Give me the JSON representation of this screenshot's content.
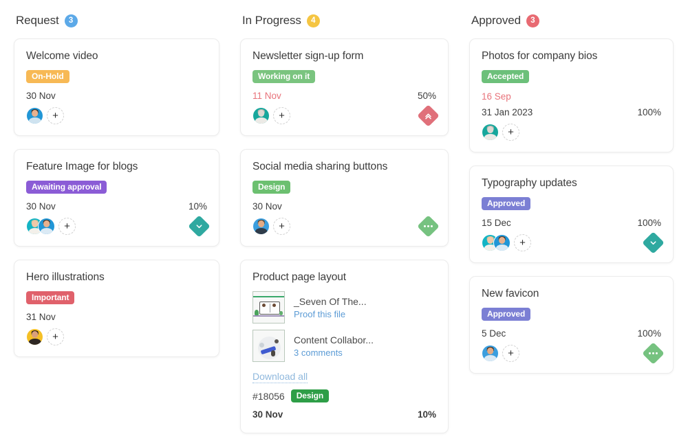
{
  "board": {
    "columns": [
      {
        "title": "Request",
        "count": "3",
        "count_color": "#5ca9e8",
        "cards": [
          {
            "title": "Welcome video",
            "tag": {
              "label": "On-Hold",
              "color": "#f7b955"
            },
            "date": "30 Nov",
            "date_alert": false,
            "percent": "",
            "avatars": [
              {
                "bg": "#2196d6",
                "skin": "#e8b18e",
                "hair": "#3b2a20",
                "body": "#cfe3f0"
              }
            ],
            "add_label": "+",
            "priority": null
          },
          {
            "title": "Feature Image for blogs",
            "tag": {
              "label": "Awaiting approval",
              "color": "#8b5cd6"
            },
            "date": "30 Nov",
            "date_alert": false,
            "percent": "10%",
            "avatars": [
              {
                "bg": "#14b4c4",
                "skin": "#f0c8a8",
                "hair": "#d8c49a",
                "body": "#f3f0ea"
              },
              {
                "bg": "#2196d6",
                "skin": "#e8b18e",
                "hair": "#4a3425",
                "body": "#dbeaf5"
              }
            ],
            "add_label": "+",
            "priority": {
              "type": "low",
              "color": "#2fa9a0",
              "icon": "chevron-down-icon"
            }
          },
          {
            "title": "Hero illustrations",
            "tag": {
              "label": "Important",
              "color": "#e0616b"
            },
            "date": "31 Nov",
            "date_alert": false,
            "percent": "",
            "avatars": [
              {
                "bg": "#f5c026",
                "skin": "#d9a07a",
                "hair": "#241a14",
                "body": "#2e2723"
              }
            ],
            "add_label": "+",
            "priority": null
          }
        ]
      },
      {
        "title": "In Progress",
        "count": "4",
        "count_color": "#f5c542",
        "cards": [
          {
            "title": "Newsletter sign-up form",
            "tag": {
              "label": "Working on it",
              "color": "#7ac47f"
            },
            "date": "11 Nov",
            "date_alert": true,
            "percent": "50%",
            "avatars": [
              {
                "bg": "#17a79c",
                "skin": "#ded8d2",
                "hair": "#b9b4ae",
                "body": "#eceae6"
              }
            ],
            "add_label": "+",
            "priority": {
              "type": "high",
              "color": "#e0707a",
              "icon": "chevrons-up-icon"
            }
          },
          {
            "title": "Social media sharing buttons",
            "tag": {
              "label": "Design",
              "color": "#6cc070"
            },
            "date": "30 Nov",
            "date_alert": false,
            "percent": "",
            "avatars": [
              {
                "bg": "#3b9ede",
                "skin": "#e3ab85",
                "hair": "#52402f",
                "body": "#2f3c4a"
              }
            ],
            "add_label": "+",
            "priority": {
              "type": "medium",
              "color": "#76c280",
              "icon": "dots-icon"
            }
          },
          {
            "title": "Product page layout",
            "attachments": [
              {
                "name": "_Seven Of The...",
                "link": "Proof this file",
                "thumb": "thumb-a"
              },
              {
                "name": "Content Collabor...",
                "link": "3 comments",
                "thumb": "thumb-b"
              }
            ],
            "download_all": "Download all",
            "ticket_id": "#18056",
            "ticket_tag": {
              "label": "Design",
              "color": "#2e9e47"
            },
            "date": "30 Nov",
            "date_bold": true,
            "percent": "10%",
            "percent_bold": true
          }
        ]
      },
      {
        "title": "Approved",
        "count": "3",
        "count_color": "#e86a72",
        "cards": [
          {
            "title": "Photos for company bios",
            "tag": {
              "label": "Accepted",
              "color": "#6cc07a"
            },
            "date_alert_text": "16 Sep",
            "date": "31 Jan 2023",
            "date_alert": false,
            "percent": "100%",
            "avatars": [
              {
                "bg": "#17a79c",
                "skin": "#ded8d2",
                "hair": "#b9b4ae",
                "body": "#eceae6"
              }
            ],
            "add_label": "+",
            "priority": null
          },
          {
            "title": "Typography updates",
            "tag": {
              "label": "Approved",
              "color": "#7b7fd4"
            },
            "date": "15 Dec",
            "date_alert": false,
            "percent": "100%",
            "avatars": [
              {
                "bg": "#14b4c4",
                "skin": "#f0c8a8",
                "hair": "#d8c49a",
                "body": "#f3f0ea"
              },
              {
                "bg": "#2196d6",
                "skin": "#e8b18e",
                "hair": "#4a3425",
                "body": "#dbeaf5"
              }
            ],
            "add_label": "+",
            "priority": {
              "type": "low",
              "color": "#2fa9a0",
              "icon": "chevron-down-icon"
            }
          },
          {
            "title": "New favicon",
            "tag": {
              "label": "Approved",
              "color": "#7b7fd4"
            },
            "date": "5 Dec",
            "date_alert": false,
            "percent": "100%",
            "avatars": [
              {
                "bg": "#3b9ede",
                "skin": "#e3ab85",
                "hair": "#3f2e22",
                "body": "#dbeaf5"
              }
            ],
            "add_label": "+",
            "priority": {
              "type": "medium",
              "color": "#76c280",
              "icon": "dots-icon"
            }
          }
        ]
      }
    ]
  }
}
